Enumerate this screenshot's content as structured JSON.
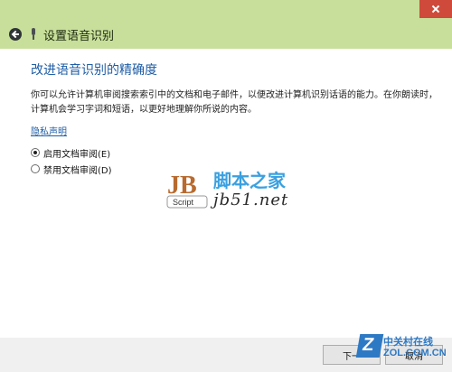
{
  "header": {
    "title": "设置语音识别"
  },
  "main": {
    "heading": "改进语音识别的精确度",
    "description": "你可以允许计算机审阅搜索索引中的文档和电子邮件，以便改进计算机识别话语的能力。在你朗读时，计算机会学习字词和短语，以更好地理解你所说的内容。",
    "privacy_link": "隐私声明",
    "options": [
      {
        "label": "启用文档审阅(E)",
        "selected": true
      },
      {
        "label": "禁用文档审阅(D)",
        "selected": false
      }
    ]
  },
  "footer": {
    "next_label": "下一",
    "cancel_label": "取消"
  },
  "watermark": {
    "site_name": "脚本之家",
    "url": "jb51.net",
    "logo_text": "Script",
    "logo_letters": "JB"
  },
  "zol": {
    "cn": "中关村在线",
    "en": "ZOL.COM.CN"
  },
  "colors": {
    "title_bar": "#c7df9a",
    "accent": "#1f5ea6",
    "close": "#cf4a3a"
  }
}
